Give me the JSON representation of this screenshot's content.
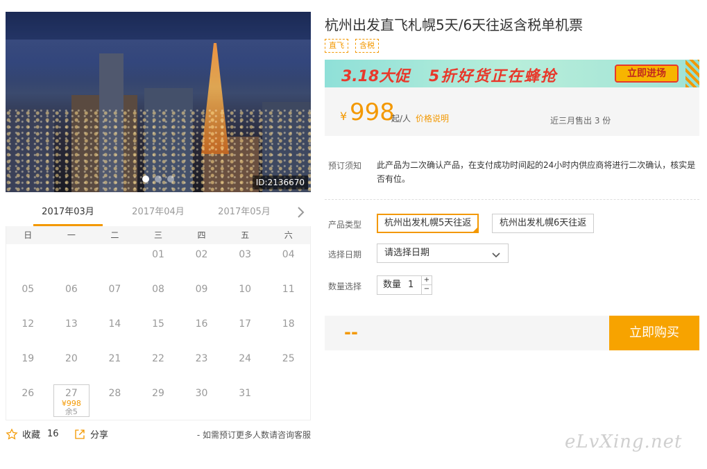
{
  "gallery": {
    "image_id": "ID:2136670",
    "slide_count": 3,
    "active_slide": 1
  },
  "calendar": {
    "months": [
      "2017年03月",
      "2017年04月",
      "2017年05月"
    ],
    "active_month": 0,
    "weekdays": [
      "日",
      "一",
      "二",
      "三",
      "四",
      "五",
      "六"
    ],
    "leading_blanks": 3,
    "days": [
      "01",
      "02",
      "03",
      "04",
      "05",
      "06",
      "07",
      "08",
      "09",
      "10",
      "11",
      "12",
      "13",
      "14",
      "15",
      "16",
      "17",
      "18",
      "19",
      "20",
      "21",
      "22",
      "23",
      "24",
      "25",
      "26",
      "27",
      "28",
      "29",
      "30",
      "31"
    ],
    "selected_day": {
      "day": "27",
      "price": "¥998",
      "stock": "余5"
    }
  },
  "actions": {
    "favorite_label": "收藏",
    "favorite_count": "16",
    "share_label": "分享",
    "consult_text": "- 如需预订更多人数请咨询客服"
  },
  "product": {
    "title": "杭州出发直飞札幌5天/6天往返含税单机票",
    "tags": [
      "直飞",
      "含税"
    ]
  },
  "promo": {
    "date_text": "3.18大促",
    "slogan": "5折好货正在蜂抢",
    "button": "立即进场"
  },
  "price": {
    "currency": "¥",
    "amount": "998",
    "unit": "起/人",
    "desc_link": "价格说明",
    "sold": "近三月售出 3 份"
  },
  "notice": {
    "label": "预订须知",
    "text": "此产品为二次确认产品，在支付成功时间起的24小时内供应商将进行二次确认，核实是否有位。"
  },
  "options": {
    "type_label": "产品类型",
    "types": [
      "杭州出发札幌5天往返",
      "杭州出发札幌6天往返"
    ],
    "active_type": 0,
    "date_label": "选择日期",
    "date_placeholder": "请选择日期",
    "qty_label": "数量选择",
    "qty_field_label": "数量",
    "qty_value": "1",
    "qty_plus": "+",
    "qty_minus": "−"
  },
  "buy": {
    "total": "--",
    "button": "立即购买"
  },
  "watermark": "eLvXing.net",
  "colors": {
    "accent": "#f39800",
    "buy_button": "#f7a300",
    "promo_bg": "#8fe0d8",
    "promo_text": "#e8382b"
  }
}
